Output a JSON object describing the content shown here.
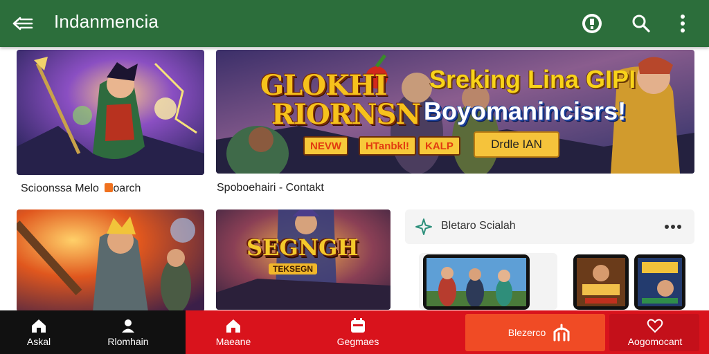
{
  "app": {
    "title": "Indanmencia"
  },
  "captions": {
    "hero_left": "Scioonssa Melo",
    "hero_left_tag": "oarch",
    "hero_right": "Spoboehairi - Contakt"
  },
  "banner": {
    "logo_line1": "GLOKHI",
    "logo_line2": "RIORNSN",
    "headline1": "Sreking Lina GIPI",
    "headline2": "Boyomanincisrs!",
    "tags": [
      "NEVW",
      "HTanbkl!",
      "KALP"
    ],
    "cta": "Drdle IAN"
  },
  "game_tile": {
    "title": "SEGNGH",
    "subtitle": "TEKSEGN"
  },
  "panel": {
    "label": "Bletaro Scialah"
  },
  "icons": {
    "back": "back-arrow-icon",
    "badge": "badge-icon",
    "search": "search-icon",
    "more": "more-vert-icon"
  },
  "bottom_nav": {
    "items": [
      {
        "label": "Askal",
        "icon": "home-icon"
      },
      {
        "label": "Rlomhain",
        "icon": "profile-icon"
      },
      {
        "label": "Maeane",
        "icon": "home-icon"
      },
      {
        "label": "Gegmaes",
        "icon": "calendar-icon"
      },
      {
        "label": "Blezerco",
        "icon": "grip-icon"
      },
      {
        "label": "Aogomocant",
        "icon": "heart-icon"
      }
    ]
  },
  "colors": {
    "appbar": "#2c6e3b",
    "nav_dark": "#111111",
    "nav_red": "#d9131c",
    "nav_orange": "#f04b25"
  }
}
